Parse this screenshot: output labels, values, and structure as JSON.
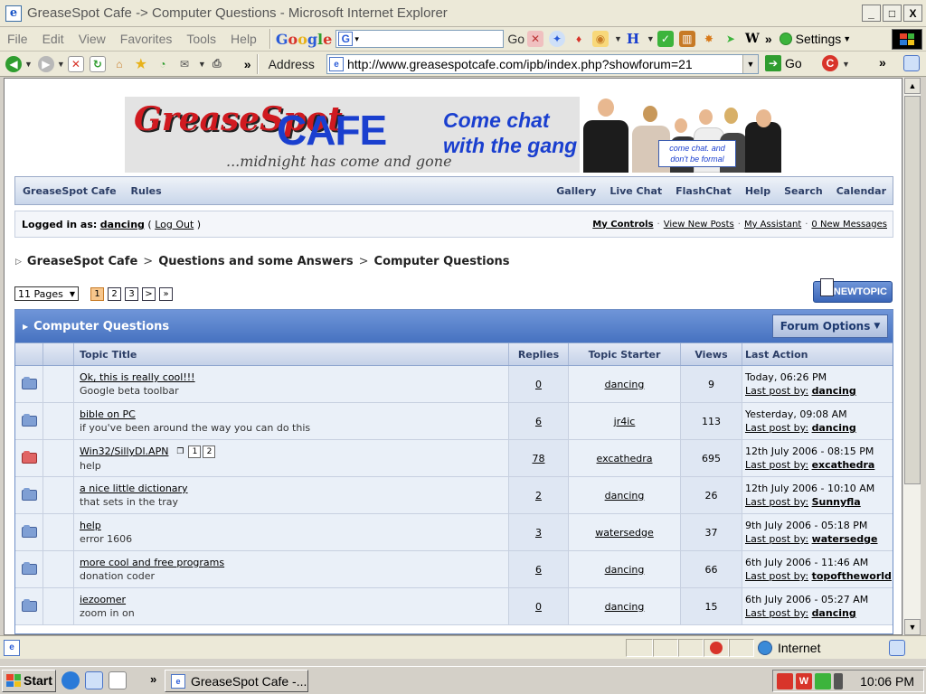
{
  "window": {
    "title": "GreaseSpot Cafe -> Computer Questions - Microsoft Internet Explorer",
    "min": "_",
    "max": "□",
    "close": "X"
  },
  "menubar": {
    "items": [
      "File",
      "Edit",
      "View",
      "Favorites",
      "Tools",
      "Help"
    ],
    "google_label": "Google",
    "go_label": "Go",
    "more": "»",
    "settings_label": "Settings"
  },
  "addressbar": {
    "label": "Address",
    "url": "http://www.greasespotcafe.com/ipb/index.php?showforum=21",
    "go_label": "Go",
    "more": "»"
  },
  "banner": {
    "logo_script": "GreaseSpot",
    "logo_cafe": "CAFE",
    "tagline": "...midnight has come and gone",
    "cta_line1": "Come chat",
    "cta_line2": "with the gang",
    "bubble_line1": "come chat.  and",
    "bubble_line2": "don't be formal"
  },
  "nav": {
    "left": [
      "GreaseSpot Cafe",
      "Rules"
    ],
    "right": [
      "Gallery",
      "Live Chat",
      "FlashChat",
      "Help",
      "Search",
      "Calendar"
    ]
  },
  "userbar": {
    "logged_in_label": "Logged in as:",
    "username": "dancing",
    "logout_label": "Log Out",
    "links": [
      "My Controls",
      "View New Posts",
      "My Assistant",
      "0 New Messages"
    ]
  },
  "breadcrumb": [
    "GreaseSpot Cafe",
    "Questions and some Answers",
    "Computer Questions"
  ],
  "pager": {
    "pages_label": "11 Pages",
    "pages": [
      "1",
      "2",
      "3"
    ],
    "next": ">",
    "last": "»",
    "current": "1"
  },
  "new_topic_label": "NEWTOPIC",
  "forum": {
    "title": "Computer Questions",
    "options_label": "Forum Options",
    "columns": {
      "title": "Topic Title",
      "replies": "Replies",
      "starter": "Topic Starter",
      "views": "Views",
      "last": "Last Action"
    },
    "last_post_label": "Last post by:",
    "topics": [
      {
        "title": "Ok, this is really cool!!!",
        "desc": "Google beta toolbar",
        "replies": "0",
        "starter": "dancing",
        "views": "9",
        "date": "Today, 06:26 PM",
        "last_by": "dancing",
        "hot": false
      },
      {
        "title": "bible on PC",
        "desc": "if you've been around the way you can do this",
        "replies": "6",
        "starter": "jr4ic",
        "views": "113",
        "date": "Yesterday, 09:08 AM",
        "last_by": "dancing",
        "hot": false
      },
      {
        "title": "Win32/SillyDl.APN",
        "desc": "help",
        "replies": "78",
        "starter": "excathedra",
        "views": "695",
        "date": "12th July 2006 - 08:15 PM",
        "last_by": "excathedra",
        "hot": true,
        "mini_pages": [
          "1",
          "2"
        ]
      },
      {
        "title": "a nice little dictionary",
        "desc": "that sets in the tray",
        "replies": "2",
        "starter": "dancing",
        "views": "26",
        "date": "12th July 2006 - 10:10 AM",
        "last_by": "Sunnyfla",
        "hot": false
      },
      {
        "title": "help",
        "desc": "error 1606",
        "replies": "3",
        "starter": "watersedge",
        "views": "37",
        "date": "9th July 2006 - 05:18 PM",
        "last_by": "watersedge",
        "hot": false
      },
      {
        "title": "more cool and free programs",
        "desc": "donation coder",
        "replies": "6",
        "starter": "dancing",
        "views": "66",
        "date": "6th July 2006 - 11:46 AM",
        "last_by": "topoftheworld",
        "hot": false
      },
      {
        "title": "iezoomer",
        "desc": "zoom in on",
        "replies": "0",
        "starter": "dancing",
        "views": "15",
        "date": "6th July 2006 - 05:27 AM",
        "last_by": "dancing",
        "hot": false
      }
    ]
  },
  "statusbar": {
    "zone": "Internet"
  },
  "taskbar": {
    "start_label": "Start",
    "task_label": "GreaseSpot Cafe -...",
    "more": "»",
    "clock": "10:06 PM"
  },
  "colors": {
    "accent": "#4672c0",
    "hot_folder": "#e06464",
    "folder": "#7f9fd4"
  }
}
